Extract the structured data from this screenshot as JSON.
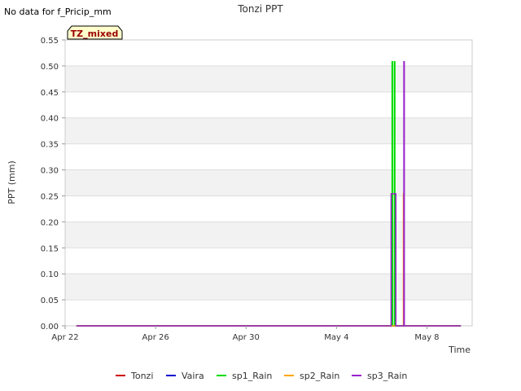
{
  "notice": "No data for f_Pricip_mm",
  "badge": "TZ_mixed",
  "chart_data": {
    "type": "line",
    "title": "Tonzi PPT",
    "xlabel": "Time",
    "ylabel": "PPT (mm)",
    "xlim": [
      "2023-04-22",
      "2023-05-10"
    ],
    "ylim": [
      0,
      0.55
    ],
    "x_ticks": [
      {
        "date": "2023-04-22",
        "label": "Apr 22"
      },
      {
        "date": "2023-04-26",
        "label": "Apr 26"
      },
      {
        "date": "2023-04-30",
        "label": "Apr 30"
      },
      {
        "date": "2023-05-04",
        "label": "May 4"
      },
      {
        "date": "2023-05-08",
        "label": "May 8"
      }
    ],
    "y_ticks": [
      "0.00",
      "0.05",
      "0.10",
      "0.15",
      "0.20",
      "0.25",
      "0.30",
      "0.35",
      "0.40",
      "0.45",
      "0.50",
      "0.55"
    ],
    "grid": true,
    "legend_position": "bottom",
    "series": [
      {
        "name": "Tonzi",
        "color": "#cc0000",
        "points": [
          [
            "2023-04-22T12:00",
            0
          ],
          [
            "2023-05-09T12:00",
            0
          ]
        ]
      },
      {
        "name": "Vaira",
        "color": "#0000cc",
        "points": [
          [
            "2023-04-22T12:00",
            0
          ],
          [
            "2023-05-09T12:00",
            0
          ]
        ]
      },
      {
        "name": "sp1_Rain",
        "color": "#00dd00",
        "points": [
          [
            "2023-04-22T12:00",
            0
          ],
          [
            "2023-05-06T11:00",
            0
          ],
          [
            "2023-05-06T11:00",
            0.508
          ],
          [
            "2023-05-06T11:30",
            0.508
          ],
          [
            "2023-05-06T11:30",
            0
          ],
          [
            "2023-05-06T13:30",
            0
          ],
          [
            "2023-05-06T13:30",
            0.508
          ],
          [
            "2023-05-06T14:00",
            0.508
          ],
          [
            "2023-05-06T14:00",
            0
          ],
          [
            "2023-05-09T12:00",
            0
          ]
        ]
      },
      {
        "name": "sp2_Rain",
        "color": "#ffa500",
        "points": [
          [
            "2023-04-22T12:00",
            0
          ],
          [
            "2023-05-06T23:00",
            0
          ],
          [
            "2023-05-06T23:00",
            0.254
          ],
          [
            "2023-05-06T23:30",
            0.254
          ],
          [
            "2023-05-06T23:30",
            0
          ],
          [
            "2023-05-09T12:00",
            0
          ]
        ]
      },
      {
        "name": "sp3_Rain",
        "color": "#9922cc",
        "points": [
          [
            "2023-04-22T12:00",
            0
          ],
          [
            "2023-05-06T10:00",
            0
          ],
          [
            "2023-05-06T10:00",
            0.254
          ],
          [
            "2023-05-06T15:00",
            0.254
          ],
          [
            "2023-05-06T15:00",
            0
          ],
          [
            "2023-05-06T23:30",
            0
          ],
          [
            "2023-05-06T23:30",
            0.508
          ],
          [
            "2023-05-07T00:00",
            0.508
          ],
          [
            "2023-05-07T00:00",
            0
          ],
          [
            "2023-05-09T12:00",
            0
          ]
        ]
      }
    ]
  }
}
